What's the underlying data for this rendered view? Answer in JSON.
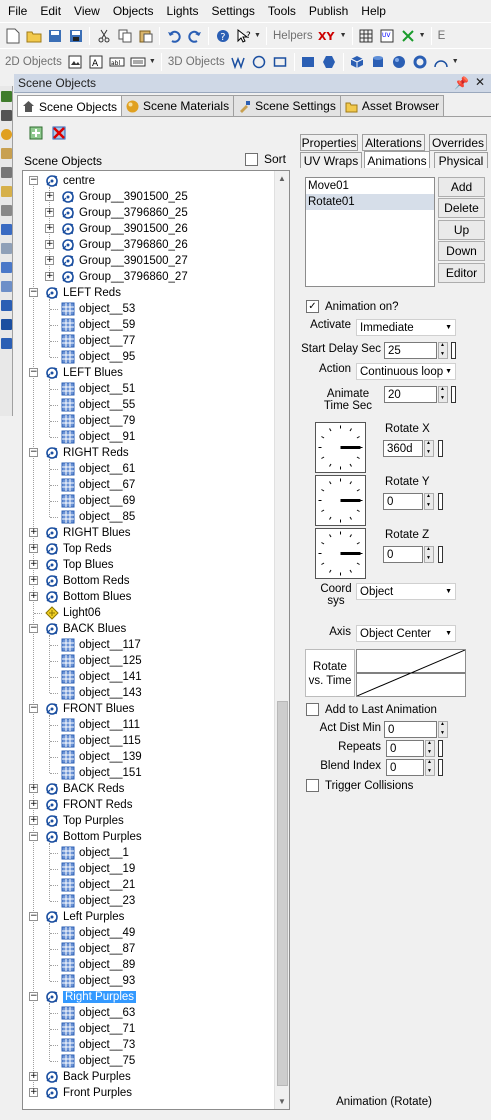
{
  "menubar": {
    "items": [
      "File",
      "Edit",
      "View",
      "Objects",
      "Lights",
      "Settings",
      "Tools",
      "Publish",
      "Help"
    ]
  },
  "toolbar2": {
    "objects2d": "2D Objects",
    "objects3d": "3D Objects",
    "helpers": "Helpers",
    "xy": "XY"
  },
  "panel": {
    "title": "Scene Objects"
  },
  "tabs": [
    {
      "label": "Scene Objects",
      "icon": "scene-objects-icon"
    },
    {
      "label": "Scene Materials",
      "icon": "scene-materials-icon"
    },
    {
      "label": "Scene Settings",
      "icon": "scene-settings-icon"
    },
    {
      "label": "Asset Browser",
      "icon": "asset-browser-icon"
    }
  ],
  "tree_header": {
    "label": "Scene Objects",
    "sort_label": "Sort",
    "sort_checked": false
  },
  "tree": {
    "rows": [
      {
        "label": "centre",
        "level": 1,
        "icon": "group-icon",
        "expander": "-"
      },
      {
        "label": "Group__3901500_25",
        "level": 2,
        "icon": "group-icon",
        "expander": "+"
      },
      {
        "label": "Group__3796860_25",
        "level": 2,
        "icon": "group-icon",
        "expander": "+"
      },
      {
        "label": "Group__3901500_26",
        "level": 2,
        "icon": "group-icon",
        "expander": "+"
      },
      {
        "label": "Group__3796860_26",
        "level": 2,
        "icon": "group-icon",
        "expander": "+"
      },
      {
        "label": "Group__3901500_27",
        "level": 2,
        "icon": "group-icon",
        "expander": "+"
      },
      {
        "label": "Group__3796860_27",
        "level": 2,
        "icon": "group-icon",
        "expander": "+"
      },
      {
        "label": "LEFT Reds",
        "level": 1,
        "icon": "group-icon",
        "expander": "-"
      },
      {
        "label": "object__53",
        "level": 2,
        "icon": "mesh-icon",
        "expander": ""
      },
      {
        "label": "object__59",
        "level": 2,
        "icon": "mesh-icon",
        "expander": ""
      },
      {
        "label": "object__77",
        "level": 2,
        "icon": "mesh-icon",
        "expander": ""
      },
      {
        "label": "object__95",
        "level": 2,
        "icon": "mesh-icon",
        "expander": ""
      },
      {
        "label": "LEFT Blues",
        "level": 1,
        "icon": "group-icon",
        "expander": "-"
      },
      {
        "label": "object__51",
        "level": 2,
        "icon": "mesh-icon",
        "expander": ""
      },
      {
        "label": "object__55",
        "level": 2,
        "icon": "mesh-icon",
        "expander": ""
      },
      {
        "label": "object__79",
        "level": 2,
        "icon": "mesh-icon",
        "expander": ""
      },
      {
        "label": "object__91",
        "level": 2,
        "icon": "mesh-icon",
        "expander": ""
      },
      {
        "label": "RIGHT Reds",
        "level": 1,
        "icon": "group-icon",
        "expander": "-"
      },
      {
        "label": "object__61",
        "level": 2,
        "icon": "mesh-icon",
        "expander": ""
      },
      {
        "label": "object__67",
        "level": 2,
        "icon": "mesh-icon",
        "expander": ""
      },
      {
        "label": "object__69",
        "level": 2,
        "icon": "mesh-icon",
        "expander": ""
      },
      {
        "label": "object__85",
        "level": 2,
        "icon": "mesh-icon",
        "expander": ""
      },
      {
        "label": "RIGHT Blues",
        "level": 1,
        "icon": "group-icon",
        "expander": "+"
      },
      {
        "label": "Top Reds",
        "level": 1,
        "icon": "group-icon",
        "expander": "+"
      },
      {
        "label": "Top Blues",
        "level": 1,
        "icon": "group-icon",
        "expander": "+"
      },
      {
        "label": "Bottom Reds",
        "level": 1,
        "icon": "group-icon",
        "expander": "+"
      },
      {
        "label": "Bottom Blues",
        "level": 1,
        "icon": "group-icon",
        "expander": "+"
      },
      {
        "label": "Light06",
        "level": 1,
        "icon": "light-icon",
        "expander": ""
      },
      {
        "label": "BACK Blues",
        "level": 1,
        "icon": "group-icon",
        "expander": "-"
      },
      {
        "label": "object__117",
        "level": 2,
        "icon": "mesh-icon",
        "expander": ""
      },
      {
        "label": "object__125",
        "level": 2,
        "icon": "mesh-icon",
        "expander": ""
      },
      {
        "label": "object__141",
        "level": 2,
        "icon": "mesh-icon",
        "expander": ""
      },
      {
        "label": "object__143",
        "level": 2,
        "icon": "mesh-icon",
        "expander": ""
      },
      {
        "label": "FRONT Blues",
        "level": 1,
        "icon": "group-icon",
        "expander": "-"
      },
      {
        "label": "object__111",
        "level": 2,
        "icon": "mesh-icon",
        "expander": ""
      },
      {
        "label": "object__115",
        "level": 2,
        "icon": "mesh-icon",
        "expander": ""
      },
      {
        "label": "object__139",
        "level": 2,
        "icon": "mesh-icon",
        "expander": ""
      },
      {
        "label": "object__151",
        "level": 2,
        "icon": "mesh-icon",
        "expander": ""
      },
      {
        "label": "BACK Reds",
        "level": 1,
        "icon": "group-icon",
        "expander": "+"
      },
      {
        "label": "FRONT Reds",
        "level": 1,
        "icon": "group-icon",
        "expander": "+"
      },
      {
        "label": "Top Purples",
        "level": 1,
        "icon": "group-icon",
        "expander": "+"
      },
      {
        "label": "Bottom Purples",
        "level": 1,
        "icon": "group-icon",
        "expander": "-"
      },
      {
        "label": "object__1",
        "level": 2,
        "icon": "mesh-icon",
        "expander": ""
      },
      {
        "label": "object__19",
        "level": 2,
        "icon": "mesh-icon",
        "expander": ""
      },
      {
        "label": "object__21",
        "level": 2,
        "icon": "mesh-icon",
        "expander": ""
      },
      {
        "label": "object__23",
        "level": 2,
        "icon": "mesh-icon",
        "expander": ""
      },
      {
        "label": "Left Purples",
        "level": 1,
        "icon": "group-icon",
        "expander": "-"
      },
      {
        "label": "object__49",
        "level": 2,
        "icon": "mesh-icon",
        "expander": ""
      },
      {
        "label": "object__87",
        "level": 2,
        "icon": "mesh-icon",
        "expander": ""
      },
      {
        "label": "object__89",
        "level": 2,
        "icon": "mesh-icon",
        "expander": ""
      },
      {
        "label": "object__93",
        "level": 2,
        "icon": "mesh-icon",
        "expander": ""
      },
      {
        "label": "Right Purples",
        "level": 1,
        "icon": "group-icon",
        "expander": "-",
        "selected": true
      },
      {
        "label": "object__63",
        "level": 2,
        "icon": "mesh-icon",
        "expander": ""
      },
      {
        "label": "object__71",
        "level": 2,
        "icon": "mesh-icon",
        "expander": ""
      },
      {
        "label": "object__73",
        "level": 2,
        "icon": "mesh-icon",
        "expander": ""
      },
      {
        "label": "object__75",
        "level": 2,
        "icon": "mesh-icon",
        "expander": ""
      },
      {
        "label": "Back Purples",
        "level": 1,
        "icon": "group-icon",
        "expander": "+"
      },
      {
        "label": "Front Purples",
        "level": 1,
        "icon": "group-icon",
        "expander": "+"
      }
    ]
  },
  "props_tabs": {
    "row1": [
      "Properties",
      "Alterations",
      "Overrides"
    ],
    "row2": [
      "UV Wraps",
      "Animations",
      "Physical"
    ],
    "active": "Animations"
  },
  "animations": {
    "list": [
      "Move01",
      "Rotate01"
    ],
    "selected_index": 1,
    "buttons": {
      "add": "Add",
      "delete": "Delete",
      "up": "Up",
      "down": "Down",
      "editor": "Editor"
    },
    "animation_on": {
      "label": "Animation on?",
      "checked": true
    },
    "activate": {
      "label": "Activate",
      "value": "Immediate"
    },
    "start_delay": {
      "label": "Start Delay Sec",
      "value": "25"
    },
    "action": {
      "label": "Action",
      "value": "Continuous loop"
    },
    "animate_time": {
      "label": "Animate Time Sec",
      "value": "20"
    },
    "rotate_x": {
      "label": "Rotate X",
      "value": "360d"
    },
    "rotate_y": {
      "label": "Rotate Y",
      "value": "0"
    },
    "rotate_z": {
      "label": "Rotate Z",
      "value": "0"
    },
    "coord_sys": {
      "label": "Coord sys",
      "value": "Object"
    },
    "axis": {
      "label": "Axis",
      "value": "Object Center"
    },
    "rotate_vs_time": {
      "label": "Rotate vs. Time"
    },
    "add_to_last": {
      "label": "Add to Last Animation",
      "checked": false
    },
    "act_dist_min": {
      "label": "Act Dist Min",
      "value": "0"
    },
    "repeats": {
      "label": "Repeats",
      "value": "0"
    },
    "blend_index": {
      "label": "Blend Index",
      "value": "0"
    },
    "trigger_collisions": {
      "label": "Trigger Collisions",
      "checked": false
    }
  },
  "status": {
    "text": "Animation (Rotate)"
  },
  "colors": {
    "selection": "#3399ff",
    "panel_title": "#cfd8e6"
  }
}
